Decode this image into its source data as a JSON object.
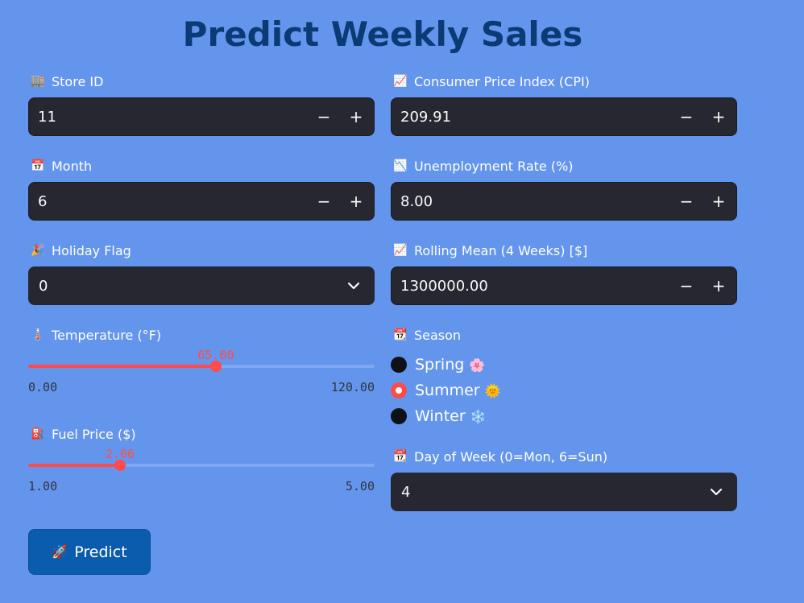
{
  "title": "Predict Weekly Sales",
  "fields": {
    "store_id": {
      "label": "Store ID",
      "value": "11",
      "icon": "store-icon",
      "emoji": "🏬"
    },
    "cpi": {
      "label": "Consumer Price Index (CPI)",
      "value": "209.91",
      "icon": "chart-up-icon",
      "emoji": "📈"
    },
    "month": {
      "label": "Month",
      "value": "6",
      "icon": "calendar-icon",
      "emoji": "📅"
    },
    "unemployment": {
      "label": "Unemployment Rate (%)",
      "value": "8.00",
      "icon": "chart-down-icon",
      "emoji": "📉"
    },
    "holiday_flag": {
      "label": "Holiday Flag",
      "value": "0",
      "icon": "party-popper-icon",
      "emoji": "🎉"
    },
    "rolling_mean": {
      "label": "Rolling Mean (4 Weeks) [$]",
      "value": "1300000.00",
      "icon": "chart-up-icon",
      "emoji": "📈"
    },
    "temperature": {
      "label": "Temperature (°F)",
      "value": 65.0,
      "value_text": "65.00",
      "min": 0.0,
      "max": 120.0,
      "min_text": "0.00",
      "max_text": "120.00",
      "icon": "thermometer-icon",
      "emoji": "🌡️"
    },
    "fuel_price": {
      "label": "Fuel Price ($)",
      "value": 2.06,
      "value_text": "2.06",
      "min": 1.0,
      "max": 5.0,
      "min_text": "1.00",
      "max_text": "5.00",
      "icon": "fuel-pump-icon",
      "emoji": "⛽"
    },
    "season": {
      "label": "Season",
      "icon": "calendar-icon",
      "emoji": "📆",
      "options": [
        {
          "label": "Spring",
          "emoji": "🌸",
          "selected": false
        },
        {
          "label": "Summer",
          "emoji": "🌞",
          "selected": true
        },
        {
          "label": "Winter",
          "emoji": "❄️",
          "selected": false
        }
      ]
    },
    "day_of_week": {
      "label": "Day of Week (0=Mon, 6=Sun)",
      "value": "4",
      "icon": "calendar-icon",
      "emoji": "📆"
    }
  },
  "steppers": {
    "minus": "−",
    "plus": "+"
  },
  "predict_button": {
    "label": "Predict",
    "icon": "rocket-icon",
    "emoji": "🚀"
  },
  "colors": {
    "background": "#6495ed",
    "title": "#0b3a75",
    "input_bg": "#262730",
    "accent": "#ff4b4b",
    "button": "#0b5cad"
  }
}
